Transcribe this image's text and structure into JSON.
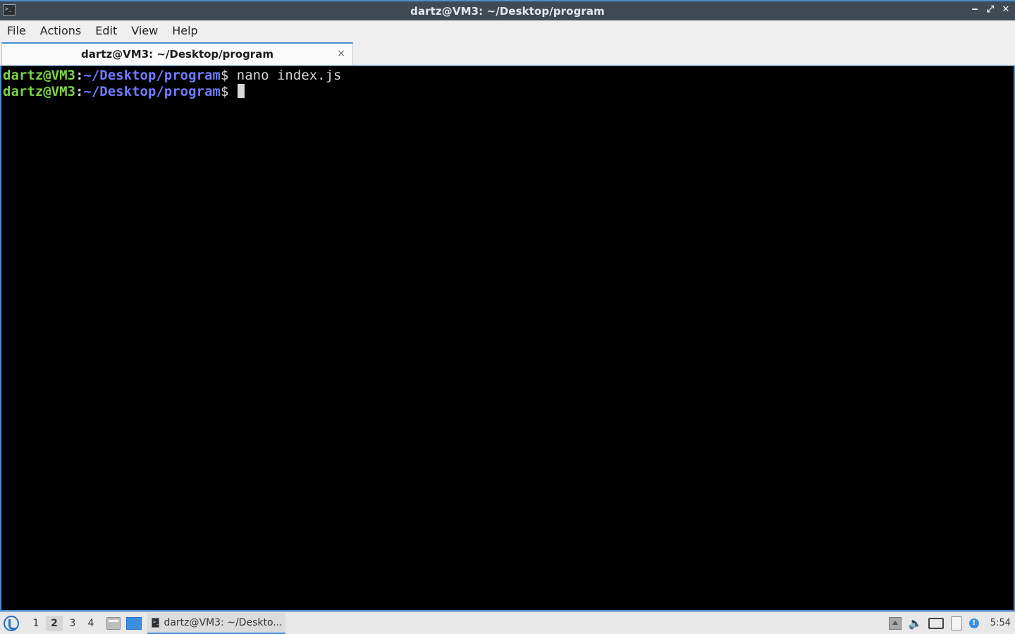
{
  "window": {
    "title": "dartz@VM3: ~/Desktop/program",
    "app_icon_glyph": ">_",
    "controls": {
      "minimize": "‒",
      "restore": "⤢",
      "close": "✕"
    }
  },
  "menu": {
    "items": [
      "File",
      "Actions",
      "Edit",
      "View",
      "Help"
    ]
  },
  "tabs": [
    {
      "label": "dartz@VM3: ~/Desktop/program",
      "close_glyph": "×"
    }
  ],
  "terminal": {
    "colors": {
      "user": "#7ed348",
      "path": "#6f7bff",
      "text": "#d7d7d7",
      "background": "#000000"
    },
    "lines": [
      {
        "user": "dartz@VM3",
        "sep": ":",
        "path": "~/Desktop/program",
        "dollar": "$",
        "command": " nano index.js"
      },
      {
        "user": "dartz@VM3",
        "sep": ":",
        "path": "~/Desktop/program",
        "dollar": "$",
        "command": " "
      }
    ]
  },
  "taskbar": {
    "start_icon": "start-menu-icon",
    "workspaces": [
      "1",
      "2",
      "3",
      "4"
    ],
    "active_workspace": "2",
    "task": {
      "label": "dartz@VM3: ~/Deskto...",
      "icon_glyph": ">_"
    },
    "tray": {
      "volume_glyph": "🔈",
      "notify_glyph": "!"
    },
    "clock": "5:54"
  }
}
